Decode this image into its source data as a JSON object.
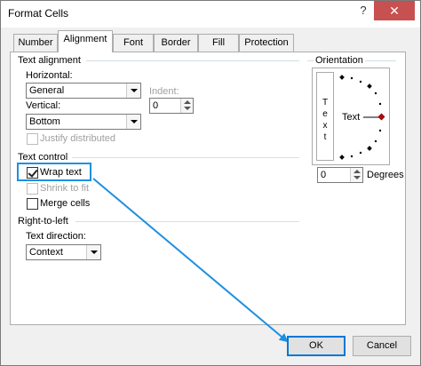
{
  "window": {
    "title": "Format Cells",
    "help": "?",
    "close": "✕"
  },
  "tabs": [
    "Number",
    "Alignment",
    "Font",
    "Border",
    "Fill",
    "Protection"
  ],
  "text_alignment": {
    "section": "Text alignment",
    "horizontal_label": "Horizontal:",
    "horizontal_value": "General",
    "indent_label": "Indent:",
    "indent_value": "0",
    "vertical_label": "Vertical:",
    "vertical_value": "Bottom",
    "justify_label": "Justify distributed"
  },
  "text_control": {
    "section": "Text control",
    "wrap_label": "Wrap text",
    "wrap_checked": true,
    "shrink_label": "Shrink to fit",
    "merge_label": "Merge cells"
  },
  "rtl": {
    "section": "Right-to-left",
    "direction_label": "Text direction:",
    "direction_value": "Context"
  },
  "orientation": {
    "section": "Orientation",
    "vertical_letters": [
      "T",
      "e",
      "x",
      "t"
    ],
    "dial_label": "Text",
    "degrees_value": "0",
    "degrees_label": "Degrees"
  },
  "footer": {
    "ok": "OK",
    "cancel": "Cancel"
  },
  "colors": {
    "accent": "#1e90e0",
    "close_bg": "#c75050",
    "dial_marker": "#c00000"
  }
}
